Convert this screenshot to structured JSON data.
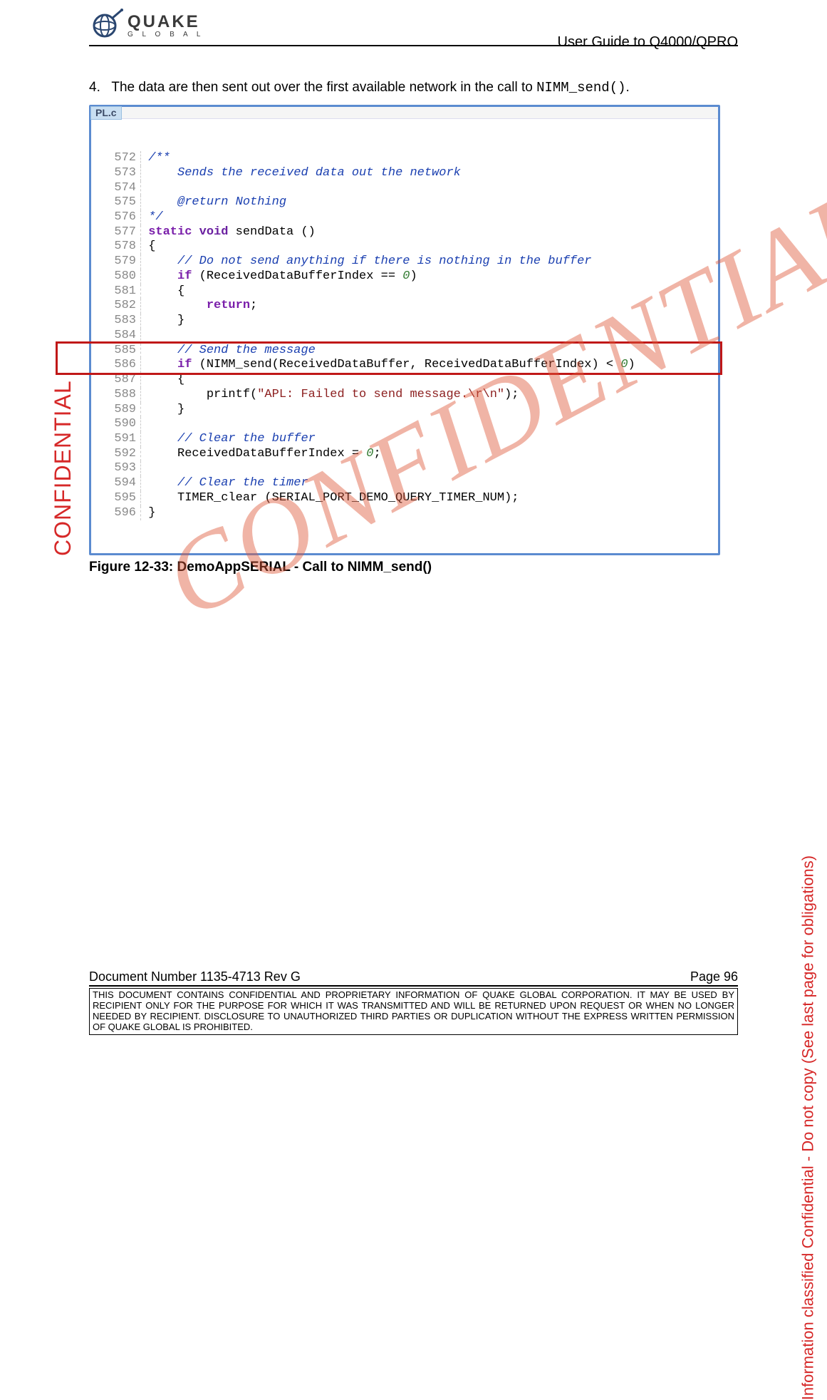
{
  "header": {
    "brand_main": "QUAKE",
    "brand_sub": "G  L  O  B  A  L",
    "doc_title": "User Guide to Q4000/QPRO"
  },
  "watermarks": {
    "left": "CONFIDENTIAL",
    "right": "Information classified Confidential - Do not copy (See last page for obligations)",
    "diagonal": "CONFIDENTIAL"
  },
  "paragraph": {
    "number": "4.",
    "text_before": "The data are then sent out over the first available network in the call to ",
    "code": "NIMM_send()",
    "text_after": "."
  },
  "codebox": {
    "tab": "PL.c",
    "lines": [
      {
        "n": "572",
        "html": "<span class='cm'>/**</span>"
      },
      {
        "n": "573",
        "html": "    <span class='cm'>Sends the received data out the network</span>"
      },
      {
        "n": "574",
        "html": ""
      },
      {
        "n": "575",
        "html": "    <span class='cm'>@return Nothing</span>"
      },
      {
        "n": "576",
        "html": "<span class='cm'>*/</span>"
      },
      {
        "n": "577",
        "html": "<span class='kw'>static</span> <span class='typ'>void</span> sendData ()"
      },
      {
        "n": "578",
        "html": "{"
      },
      {
        "n": "579",
        "html": "    <span class='cm'>// Do not send anything if there is nothing in the buffer</span>"
      },
      {
        "n": "580",
        "html": "    <span class='kw'>if</span> (ReceivedDataBufferIndex == <span class='num'>0</span>)"
      },
      {
        "n": "581",
        "html": "    {"
      },
      {
        "n": "582",
        "html": "        <span class='kw'>return</span>;"
      },
      {
        "n": "583",
        "html": "    }"
      },
      {
        "n": "584",
        "html": ""
      },
      {
        "n": "585",
        "html": "    <span class='cm'>// Send the message</span>"
      },
      {
        "n": "586",
        "html": "    <span class='kw'>if</span> (NIMM_send(ReceivedDataBuffer, ReceivedDataBufferIndex) &lt; <span class='num'>0</span>)"
      },
      {
        "n": "587",
        "html": "    {"
      },
      {
        "n": "588",
        "html": "        printf(<span class='str'>\"APL: Failed to send message.\\r\\n\"</span>);"
      },
      {
        "n": "589",
        "html": "    }"
      },
      {
        "n": "590",
        "html": ""
      },
      {
        "n": "591",
        "html": "    <span class='cm'>// Clear the buffer</span>"
      },
      {
        "n": "592",
        "html": "    ReceivedDataBufferIndex = <span class='num'>0</span>;"
      },
      {
        "n": "593",
        "html": ""
      },
      {
        "n": "594",
        "html": "    <span class='cm'>// Clear the timer</span>"
      },
      {
        "n": "595",
        "html": "    TIMER_clear (SERIAL_PORT_DEMO_QUERY_TIMER_NUM);"
      },
      {
        "n": "596",
        "html": "}"
      }
    ]
  },
  "figure_caption": "Figure 12-33:  DemoAppSERIAL -  Call to NIMM_send()",
  "footer": {
    "doc_number": "Document Number 1135-4713   Rev G",
    "page": "Page 96",
    "disclaimer": "THIS DOCUMENT CONTAINS CONFIDENTIAL AND PROPRIETARY INFORMATION OF QUAKE GLOBAL CORPORATION.  IT MAY BE USED BY RECIPIENT ONLY FOR THE PURPOSE FOR WHICH IT WAS TRANSMITTED AND WILL BE RETURNED UPON REQUEST OR WHEN NO LONGER NEEDED BY RECIPIENT.  DISCLOSURE TO UNAUTHORIZED THIRD PARTIES OR DUPLICATION WITHOUT THE EXPRESS WRITTEN PERMISSION OF QUAKE GLOBAL IS PROHIBITED."
  }
}
